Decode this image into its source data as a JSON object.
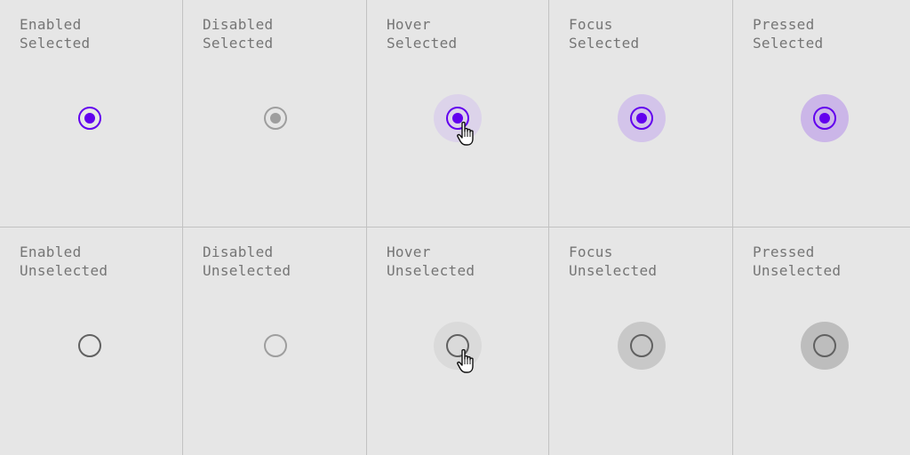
{
  "colors": {
    "background": "#e6e6e6",
    "divider": "#c2c2c2",
    "label": "#757575",
    "primary": "#6200ee",
    "disabled": "#9e9e9e",
    "unselected": "#616161",
    "hover_selected_halo": "#dcd3ea",
    "focus_selected_halo": "#d3c4ea",
    "pressed_selected_halo": "#cbb6e8",
    "hover_unselected_halo": "#dadada",
    "focus_unselected_halo": "#c8c8c8",
    "pressed_unselected_halo": "#bdbdbd"
  },
  "rows": [
    {
      "cells": [
        {
          "state": "Enabled",
          "selection": "Selected",
          "icon": "radio-selected-icon",
          "halo": "none",
          "cursor": false
        },
        {
          "state": "Disabled",
          "selection": "Selected",
          "icon": "radio-selected-icon",
          "halo": "none",
          "cursor": false
        },
        {
          "state": "Hover",
          "selection": "Selected",
          "icon": "radio-selected-icon",
          "halo": "hover",
          "cursor": true
        },
        {
          "state": "Focus",
          "selection": "Selected",
          "icon": "radio-selected-icon",
          "halo": "focus",
          "cursor": false
        },
        {
          "state": "Pressed",
          "selection": "Selected",
          "icon": "radio-selected-icon",
          "halo": "pressed",
          "cursor": false
        }
      ]
    },
    {
      "cells": [
        {
          "state": "Enabled",
          "selection": "Unselected",
          "icon": "radio-unselected-icon",
          "halo": "none",
          "cursor": false
        },
        {
          "state": "Disabled",
          "selection": "Unselected",
          "icon": "radio-unselected-icon",
          "halo": "none",
          "cursor": false
        },
        {
          "state": "Hover",
          "selection": "Unselected",
          "icon": "radio-unselected-icon",
          "halo": "hover",
          "cursor": true
        },
        {
          "state": "Focus",
          "selection": "Unselected",
          "icon": "radio-unselected-icon",
          "halo": "focus",
          "cursor": false
        },
        {
          "state": "Pressed",
          "selection": "Unselected",
          "icon": "radio-unselected-icon",
          "halo": "pressed",
          "cursor": false
        }
      ]
    }
  ]
}
